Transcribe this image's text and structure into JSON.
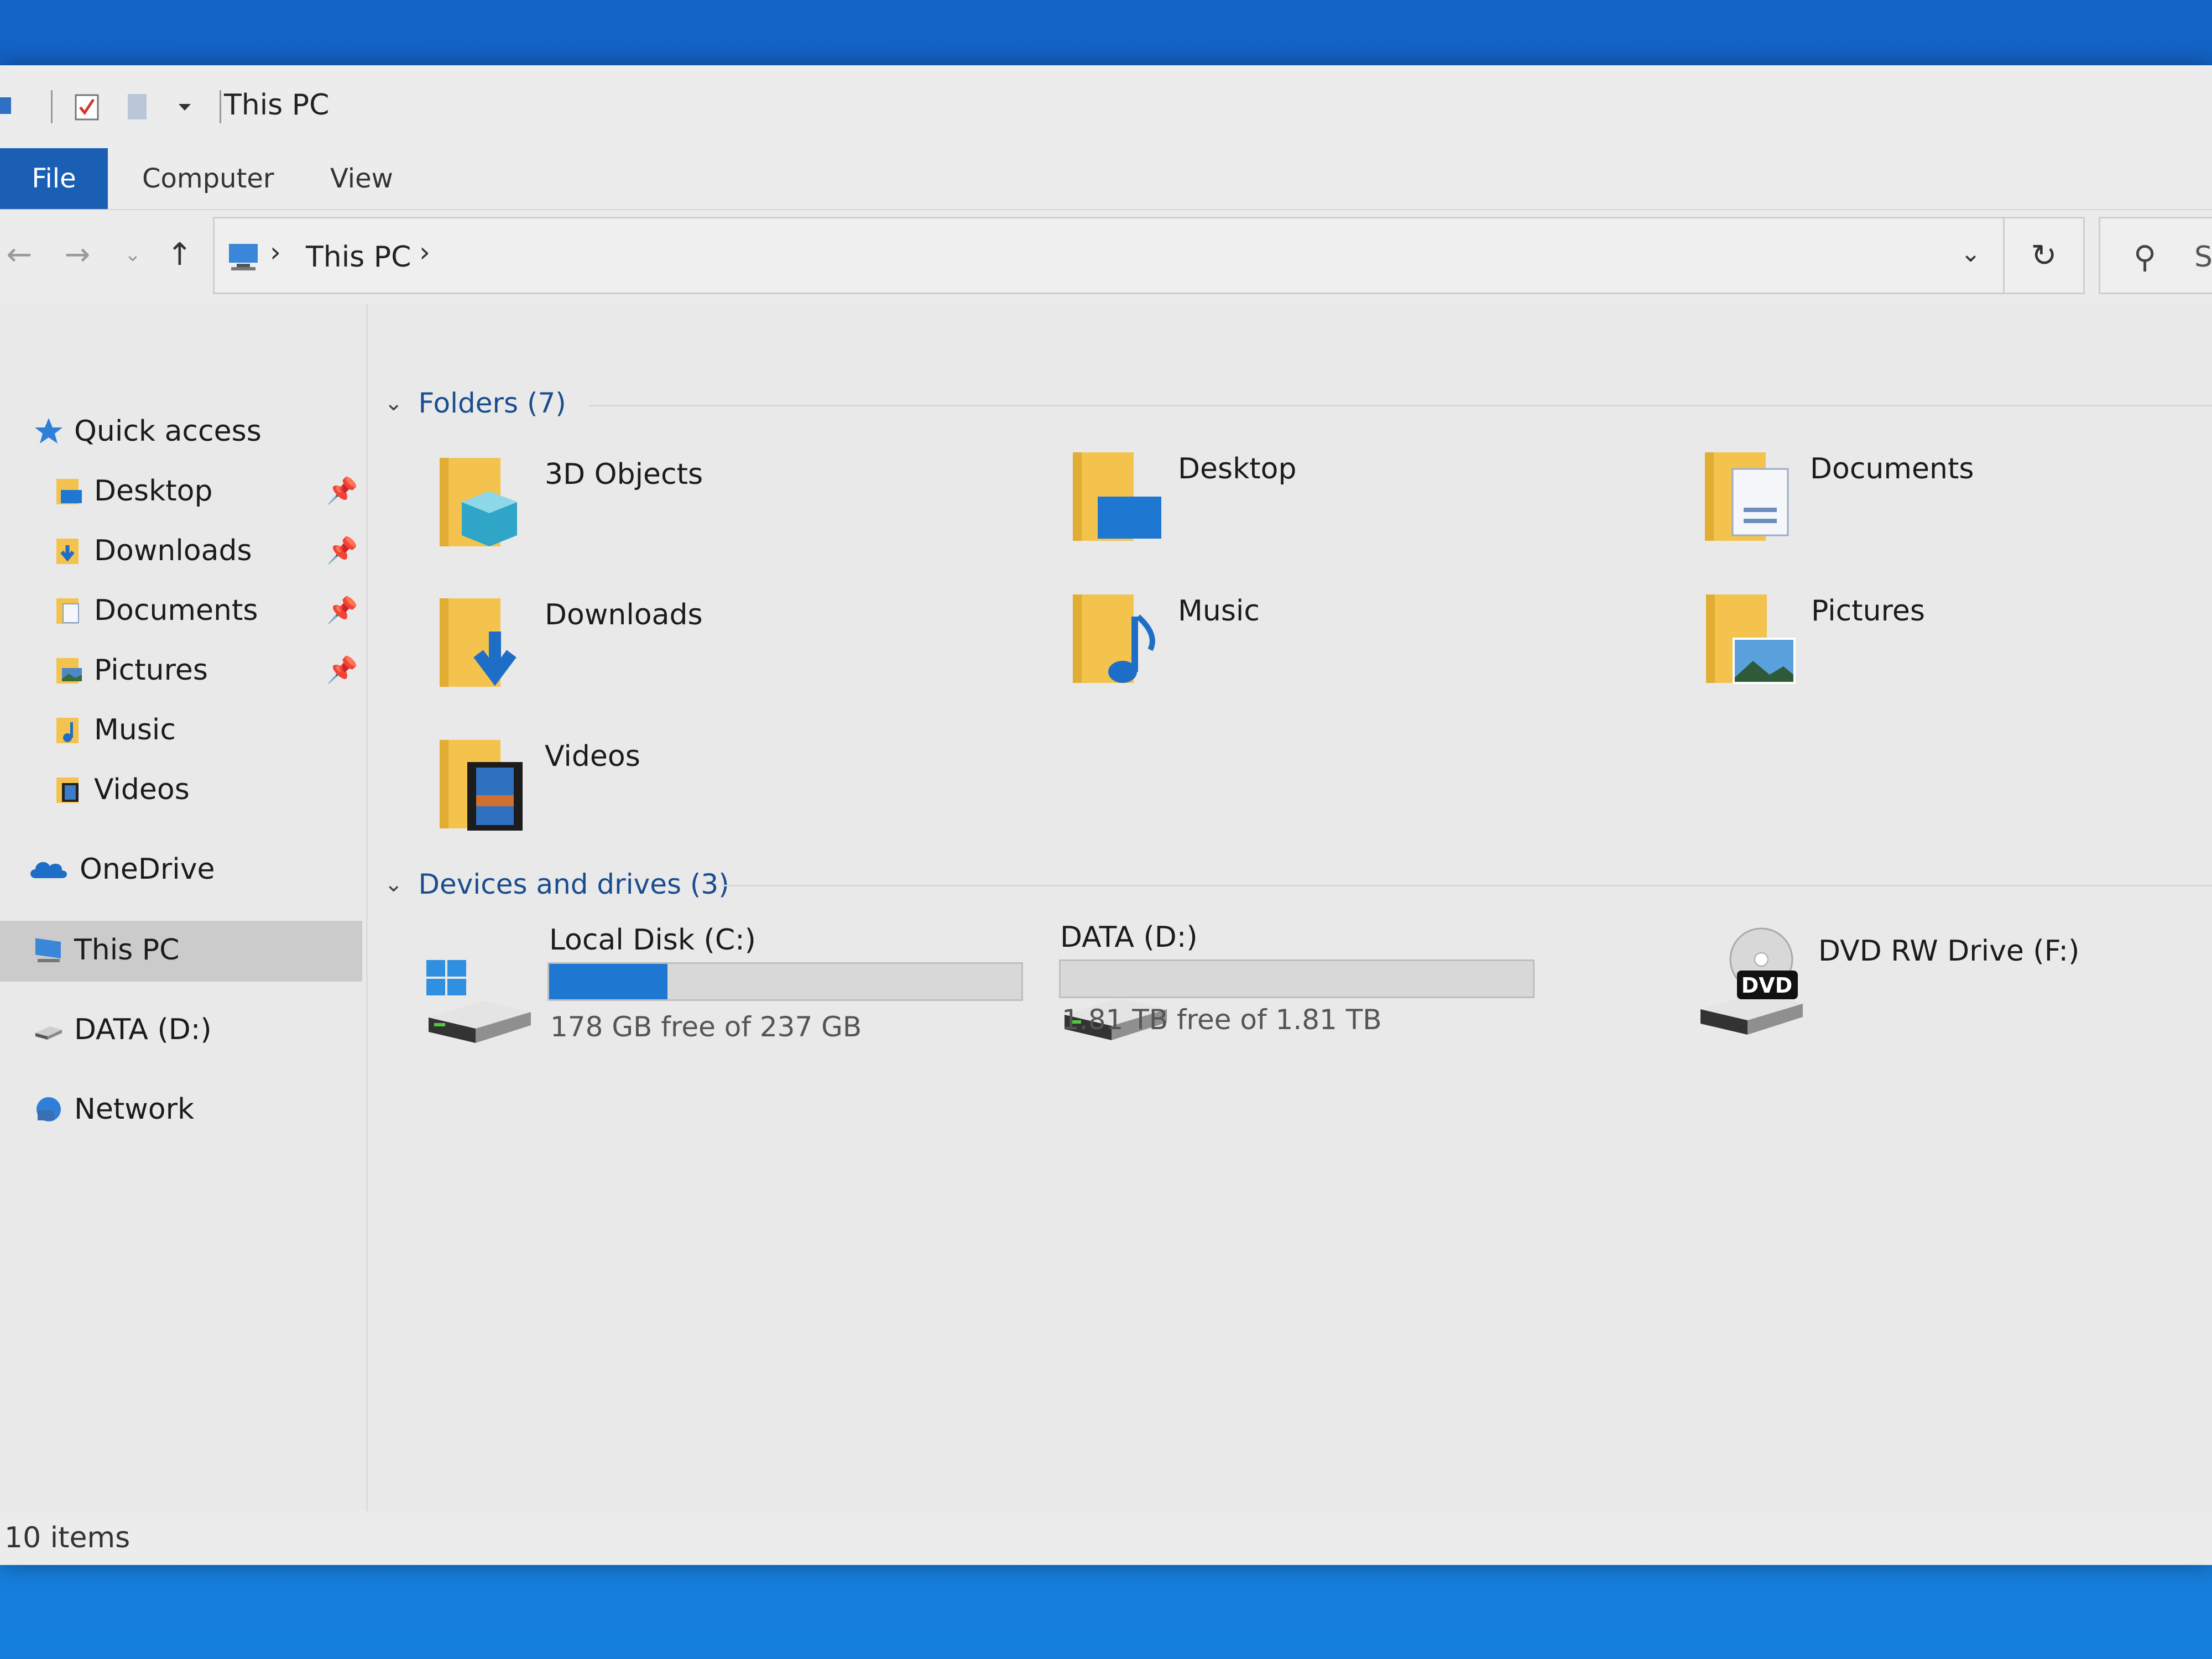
{
  "window": {
    "title": "This PC"
  },
  "ribbon": {
    "tabs": [
      "File",
      "Computer",
      "View"
    ]
  },
  "address": {
    "crumb": "This PC",
    "search_placeholder": "S"
  },
  "nav": {
    "quick_access": "Quick access",
    "items": [
      {
        "label": "Desktop",
        "pinned": true
      },
      {
        "label": "Downloads",
        "pinned": true
      },
      {
        "label": "Documents",
        "pinned": true
      },
      {
        "label": "Pictures",
        "pinned": true
      },
      {
        "label": "Music",
        "pinned": false
      },
      {
        "label": "Videos",
        "pinned": false
      }
    ],
    "onedrive": "OneDrive",
    "this_pc": "This PC",
    "data_d": "DATA (D:)",
    "network": "Network"
  },
  "folders": {
    "header": "Folders (7)",
    "items": [
      "3D Objects",
      "Desktop",
      "Documents",
      "Downloads",
      "Music",
      "Pictures",
      "Videos"
    ]
  },
  "drives": {
    "header": "Devices and drives (3)",
    "items": [
      {
        "label": "Local Disk (C:)",
        "free_text": "178 GB free of 237 GB",
        "used_fraction": 0.25
      },
      {
        "label": "DATA (D:)",
        "free_text": "1.81 TB free of 1.81 TB",
        "used_fraction": 0.0
      },
      {
        "label": "DVD RW Drive (F:)"
      }
    ],
    "dvd_badge": "DVD"
  },
  "status": {
    "items": "10 items"
  },
  "colors": {
    "accent": "#1a5fb4",
    "bar_fill": "#1e78d2",
    "folder": "#f3c34d"
  }
}
